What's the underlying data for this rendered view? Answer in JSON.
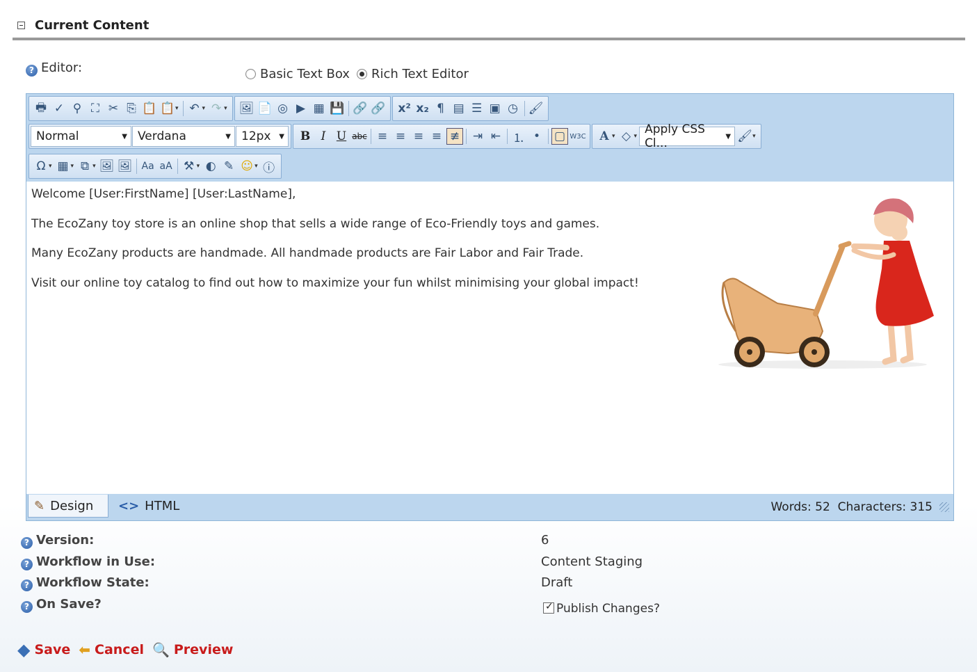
{
  "section": {
    "title": "Current Content"
  },
  "editor_choice": {
    "label": "Editor:",
    "options": [
      {
        "label": "Basic Text Box",
        "checked": false
      },
      {
        "label": "Rich Text Editor",
        "checked": true
      }
    ]
  },
  "toolbar": {
    "format_block": "Normal",
    "font_name": "Verdana",
    "font_size": "12px",
    "css_class": "Apply CSS Cl..."
  },
  "content": {
    "line1": "Welcome [User:FirstName] [User:LastName],",
    "line2": "The EcoZany toy store is an online shop that sells a wide range of Eco-Friendly toys and games.",
    "line3": "Many EcoZany products are handmade. All handmade products are Fair Labor and Fair Trade.",
    "line4": "Visit our online toy catalog to find out how to maximize your fun whilst minimising your global impact!"
  },
  "modes": {
    "design": "Design",
    "html": "HTML"
  },
  "stats": {
    "words": "Words: 52",
    "characters": "Characters: 315"
  },
  "info": {
    "version_label": "Version:",
    "version_value": "6",
    "workflow_label": "Workflow in Use:",
    "workflow_value": "Content Staging",
    "state_label": "Workflow State:",
    "state_value": "Draft",
    "onsave_label": "On Save?",
    "publish_label": "Publish Changes?"
  },
  "actions": {
    "save": "Save",
    "cancel": "Cancel",
    "preview": "Preview"
  },
  "colors": {
    "accent": "#c81b1b",
    "toolbar_bg": "#bcd6ee"
  }
}
